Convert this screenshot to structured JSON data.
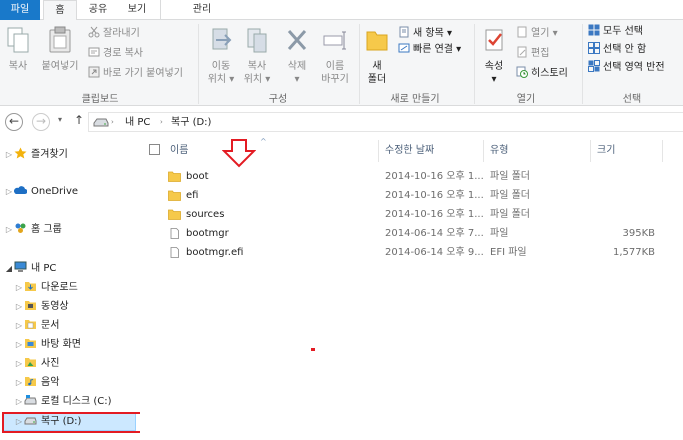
{
  "tabs": [
    "파일",
    "홈",
    "공유",
    "보기",
    "관리"
  ],
  "ribbon": {
    "clipboard": {
      "label": "클립보드",
      "copy": "복사",
      "paste": "붙여넣기",
      "cut": "잘라내기",
      "copy_path": "경로 복사",
      "paste_shortcut": "바로 가기 붙여넣기"
    },
    "organize": {
      "label": "구성",
      "move_to": [
        "이동",
        "위치 ▾"
      ],
      "copy_to": [
        "복사",
        "위치 ▾"
      ],
      "delete": [
        "삭제",
        "▾"
      ],
      "rename": [
        "이름",
        "바꾸기"
      ]
    },
    "new": {
      "label": "새로 만들기",
      "new_folder": [
        "새",
        "폴더"
      ],
      "new_item": "새 항목 ▾",
      "easy_access": "빠른 연결 ▾"
    },
    "open": {
      "label": "열기",
      "properties": [
        "속성",
        "▾"
      ],
      "open": "열기 ▾",
      "edit": "편집",
      "history": "히스토리"
    },
    "select": {
      "label": "선택",
      "select_all": "모두 선택",
      "select_none": "선택 안 함",
      "invert": "선택 영역 반전"
    }
  },
  "address": {
    "nav_back": "←",
    "nav_forward": "→",
    "nav_recent": "▾",
    "nav_up": "↑",
    "crumbs": [
      "내 PC",
      "복구 (D:)"
    ]
  },
  "columns": {
    "name": "이름",
    "modified": "수정한 날짜",
    "type": "유형",
    "size": "크기"
  },
  "files": [
    {
      "name": "boot",
      "modified": "2014-10-16 오후 1...",
      "type": "파일 폴더",
      "size": "",
      "icon": "folder-icon"
    },
    {
      "name": "efi",
      "modified": "2014-10-16 오후 1...",
      "type": "파일 폴더",
      "size": "",
      "icon": "folder-icon"
    },
    {
      "name": "sources",
      "modified": "2014-10-16 오후 1...",
      "type": "파일 폴더",
      "size": "",
      "icon": "folder-icon"
    },
    {
      "name": "bootmgr",
      "modified": "2014-06-14 오후 7...",
      "type": "파일",
      "size": "395KB",
      "icon": "file-icon"
    },
    {
      "name": "bootmgr.efi",
      "modified": "2014-06-14 오후 9...",
      "type": "EFI 파일",
      "size": "1,577KB",
      "icon": "file-icon"
    }
  ],
  "nav": {
    "favorites": "즐겨찾기",
    "onedrive": "OneDrive",
    "homegroup": "홈 그룹",
    "this_pc": "내 PC",
    "items": [
      "다운로드",
      "동영상",
      "문서",
      "바탕 화면",
      "사진",
      "음악",
      "로컬 디스크 (C:)",
      "복구 (D:)"
    ]
  },
  "colors": {
    "accent": "#1979ca",
    "selection": "#cce8ff",
    "annotation": "#e31b23"
  }
}
